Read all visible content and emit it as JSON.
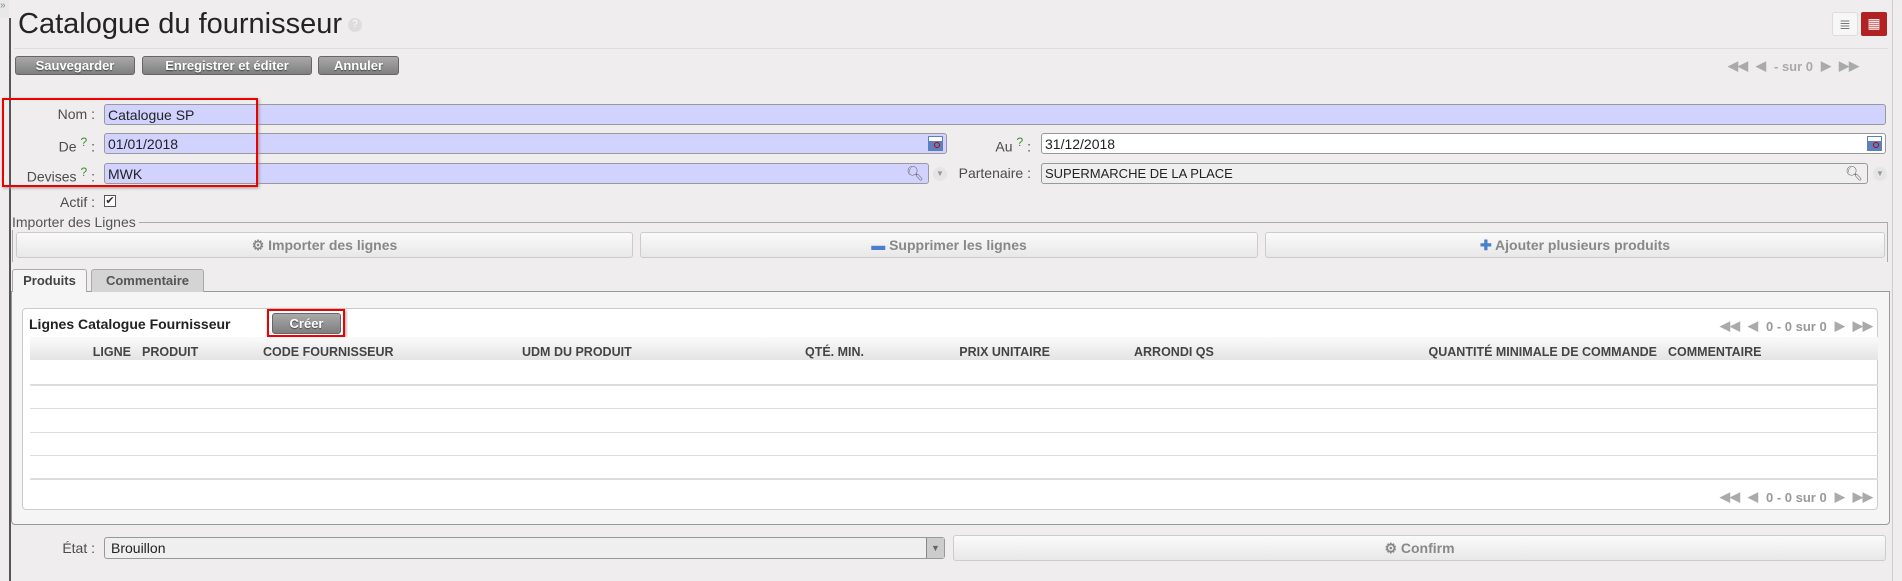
{
  "header": {
    "title": "Catalogue du fournisseur",
    "help": "?",
    "pager": "- sur 0"
  },
  "toolbar": {
    "save": "Sauvegarder",
    "save_edit": "Enregistrer et éditer",
    "cancel": "Annuler"
  },
  "sidebar_toggle": "»",
  "form": {
    "nom": {
      "label": "Nom :",
      "value": "Catalogue SP"
    },
    "de": {
      "label": "De",
      "value": "01/01/2018"
    },
    "au": {
      "label": "Au",
      "value": "31/12/2018"
    },
    "devises": {
      "label": "Devises",
      "value": "MWK"
    },
    "partenaire": {
      "label": "Partenaire :",
      "value": "SUPERMARCHE DE LA PLACE"
    },
    "actif": {
      "label": "Actif :",
      "checked": true
    },
    "help_mark": "?",
    "colon": ":"
  },
  "import": {
    "legend": "Importer des Lignes",
    "import_btn": "Importer des lignes",
    "delete_btn": "Supprimer les lignes",
    "add_btn": "Ajouter plusieurs produits"
  },
  "tabs": [
    {
      "label": "Produits",
      "active": true
    },
    {
      "label": "Commentaire",
      "active": false
    }
  ],
  "lines": {
    "title": "Lignes Catalogue Fournisseur",
    "create": "Créer",
    "pager": "0 - 0 sur 0",
    "columns": [
      "LIGNE",
      "PRODUIT",
      "CODE FOURNISSEUR",
      "UDM DU PRODUIT",
      "QTÉ. MIN.",
      "PRIX UNITAIRE",
      "ARRONDI QS",
      "QUANTITÉ MINIMALE DE COMMANDE",
      "COMMENTAIRE"
    ]
  },
  "footer": {
    "etat_label": "État :",
    "etat_value": "Brouillon",
    "confirm": "Confirm"
  },
  "colors": {
    "required_bg": "#d2d2ff",
    "highlight": "#ee0000",
    "active_view": "#b22222"
  }
}
